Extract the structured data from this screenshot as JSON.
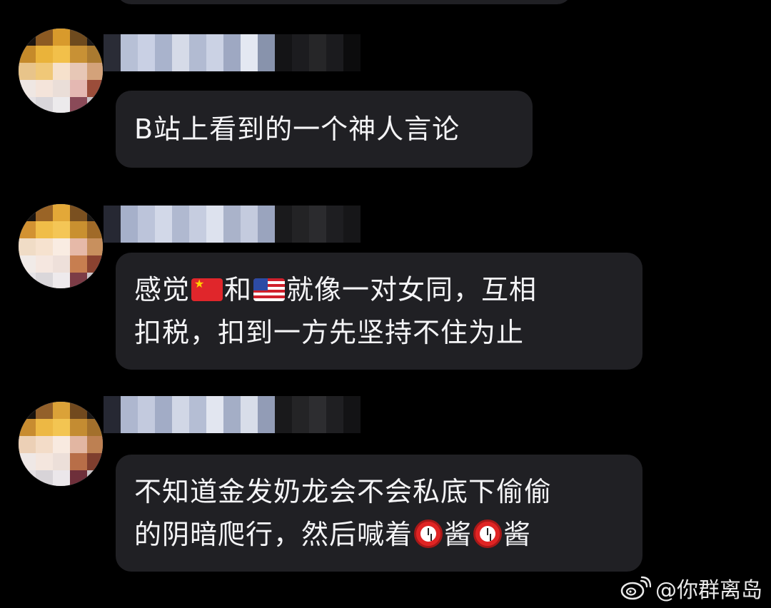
{
  "messages": [
    {
      "text_lines": [
        [
          {
            "type": "text",
            "value": "B站上看到的一个神人言论"
          }
        ]
      ]
    },
    {
      "text_lines": [
        [
          {
            "type": "text",
            "value": "感觉"
          },
          {
            "type": "emoji",
            "name": "china-flag-emoji"
          },
          {
            "type": "text",
            "value": "和"
          },
          {
            "type": "emoji",
            "name": "us-flag-emoji"
          },
          {
            "type": "text",
            "value": "就像一对女同，互相"
          }
        ],
        [
          {
            "type": "text",
            "value": "扣税，扣到一方先坚持不住为止"
          }
        ]
      ]
    },
    {
      "text_lines": [
        [
          {
            "type": "text",
            "value": "不知道金发奶龙会不会私底下偷偷"
          }
        ],
        [
          {
            "type": "text",
            "value": "的阴暗爬行，然后喊着"
          },
          {
            "type": "emoji",
            "name": "alarm-clock-emoji"
          },
          {
            "type": "text",
            "value": "酱"
          },
          {
            "type": "emoji",
            "name": "alarm-clock-emoji"
          },
          {
            "type": "text",
            "value": "酱"
          }
        ]
      ]
    }
  ],
  "watermark": {
    "text": "@你群离岛",
    "icon": "weibo-logo-icon"
  }
}
